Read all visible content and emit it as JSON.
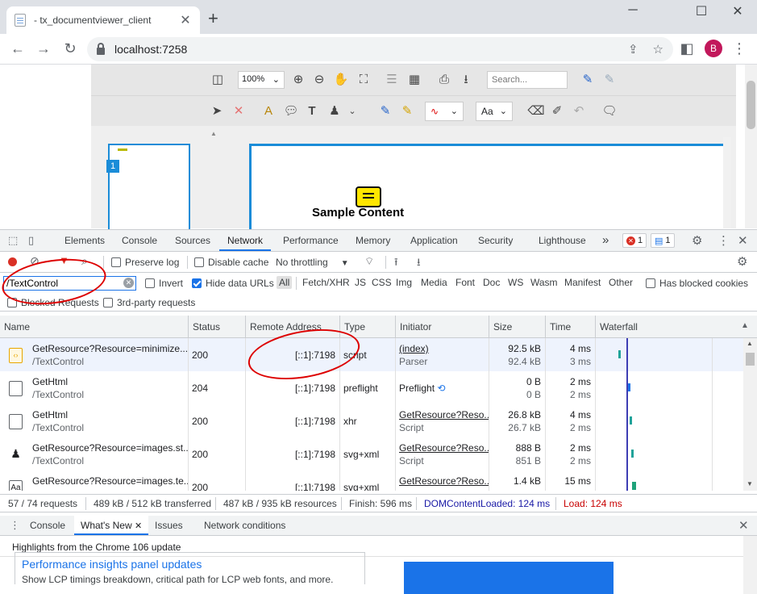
{
  "browser": {
    "tab_title": "- tx_documentviewer_client",
    "tab_close": "✕",
    "new_tab": "+",
    "url": "localhost:7258",
    "profile_initial": "B",
    "window_controls": {
      "minimize": "─",
      "maximize": "☐",
      "close": "✕"
    }
  },
  "viewer": {
    "zoom": "100%",
    "search_placeholder": "Search...",
    "font_button": "Aa",
    "page_number": "1",
    "sample_text": "Sample Content"
  },
  "devtools": {
    "tabs": [
      "Elements",
      "Console",
      "Sources",
      "Network",
      "Performance",
      "Memory",
      "Application",
      "Security",
      "Lighthouse"
    ],
    "active_tab": "Network",
    "more_tabs": "»",
    "error_count": "1",
    "message_count": "1",
    "toolbar": {
      "preserve_log": "Preserve log",
      "disable_cache": "Disable cache",
      "throttling": "No throttling"
    },
    "filter": {
      "value": "/TextControl",
      "invert": "Invert",
      "hide_data_urls": "Hide data URLs",
      "types": [
        "All",
        "Fetch/XHR",
        "JS",
        "CSS",
        "Img",
        "Media",
        "Font",
        "Doc",
        "WS",
        "Wasm",
        "Manifest",
        "Other"
      ],
      "has_blocked_cookies": "Has blocked cookies",
      "blocked_requests": "Blocked Requests",
      "third_party": "3rd-party requests"
    },
    "columns": [
      "Name",
      "Status",
      "Remote Address",
      "Type",
      "Initiator",
      "Size",
      "Time",
      "Waterfall"
    ],
    "rows": [
      {
        "name": "GetResource?Resource=minimize...",
        "path": "/TextControl",
        "status": "200",
        "remote": "[::1]:7198",
        "type": "script",
        "initiator": "(index)",
        "initiator_sub": "Parser",
        "size": "92.5 kB",
        "size_sub": "92.4 kB",
        "time": "4 ms",
        "time_sub": "3 ms",
        "icon": "script-file-icon"
      },
      {
        "name": "GetHtml",
        "path": "/TextControl",
        "status": "204",
        "remote": "[::1]:7198",
        "type": "preflight",
        "initiator": "Preflight",
        "initiator_sub": "",
        "size": "0 B",
        "size_sub": "0 B",
        "time": "2 ms",
        "time_sub": "2 ms",
        "icon": "document-file-icon"
      },
      {
        "name": "GetHtml",
        "path": "/TextControl",
        "status": "200",
        "remote": "[::1]:7198",
        "type": "xhr",
        "initiator": "GetResource?Reso...",
        "initiator_sub": "Script",
        "size": "26.8 kB",
        "size_sub": "26.7 kB",
        "time": "4 ms",
        "time_sub": "2 ms",
        "icon": "document-file-icon"
      },
      {
        "name": "GetResource?Resource=images.st...",
        "path": "/TextControl",
        "status": "200",
        "remote": "[::1]:7198",
        "type": "svg+xml",
        "initiator": "GetResource?Reso...",
        "initiator_sub": "Script",
        "size": "888 B",
        "size_sub": "851 B",
        "time": "2 ms",
        "time_sub": "2 ms",
        "icon": "stamp-image-icon"
      },
      {
        "name": "GetResource?Resource=images.te...",
        "path": "",
        "status": "200",
        "remote": "[::1]:7198",
        "type": "svg+xml",
        "initiator": "GetResource?Reso...",
        "initiator_sub": "",
        "size": "1.4 kB",
        "size_sub": "",
        "time": "15 ms",
        "time_sub": "",
        "icon": "font-image-icon"
      }
    ],
    "status_bar": {
      "requests": "57 / 74 requests",
      "transferred": "489 kB / 512 kB transferred",
      "resources": "487 kB / 935 kB resources",
      "finish": "Finish: 596 ms",
      "dom_loaded": "DOMContentLoaded: 124 ms",
      "load": "Load: 124 ms",
      "dom_color": "#1a1aa6",
      "load_color": "#c80000"
    },
    "drawer": {
      "tabs": [
        "Console",
        "What's New",
        "Issues",
        "Network conditions"
      ],
      "active_tab": "What's New",
      "headline": "Highlights from the Chrome 106 update",
      "card_title": "Performance insights panel updates",
      "card_text": "Show LCP timings breakdown, critical path for LCP web fonts, and more."
    }
  }
}
